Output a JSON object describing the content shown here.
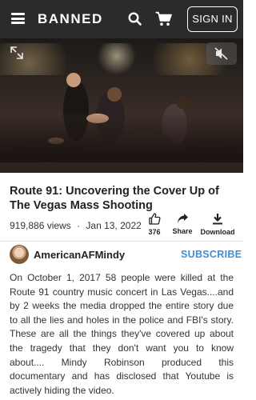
{
  "header": {
    "logo": "BANNED",
    "signin_label": "SIGN IN",
    "menu_icon": "hamburger-menu-icon",
    "search_icon": "search-icon",
    "cart_icon": "cart-icon",
    "background": "#2b2b2b"
  },
  "player": {
    "time": "--:--",
    "progress": 0,
    "icons": [
      "expand-icon",
      "mute-icon",
      "speed-icon",
      "play-icon",
      "settings-icon",
      "cast-icon",
      "fullscreen-icon"
    ]
  },
  "video": {
    "title": "Route 91: Uncovering the Cover Up of The Vegas Mass Shooting",
    "views": "919,886 views",
    "separator": "·",
    "date": "Jan 13, 2022"
  },
  "actions": {
    "like_count": "376",
    "share_label": "Share",
    "download_label": "Download"
  },
  "channel": {
    "name": "AmericanAFMindy",
    "subscribe_label": "SUBSCRIBE",
    "accent": "#3d8fd6"
  },
  "description": "On October 1, 2017 58 people were killed at the Route 91 country music concert in Las Vegas....and by 2 weeks the media dropped the entire story due to all the lies and holes in the police and FBI's story. These are all the things they've covered up about the tragedy that they don't want you to know about.... Mindy Robinson produced this documentary and has disclosed that Youtube is actively hiding the video."
}
